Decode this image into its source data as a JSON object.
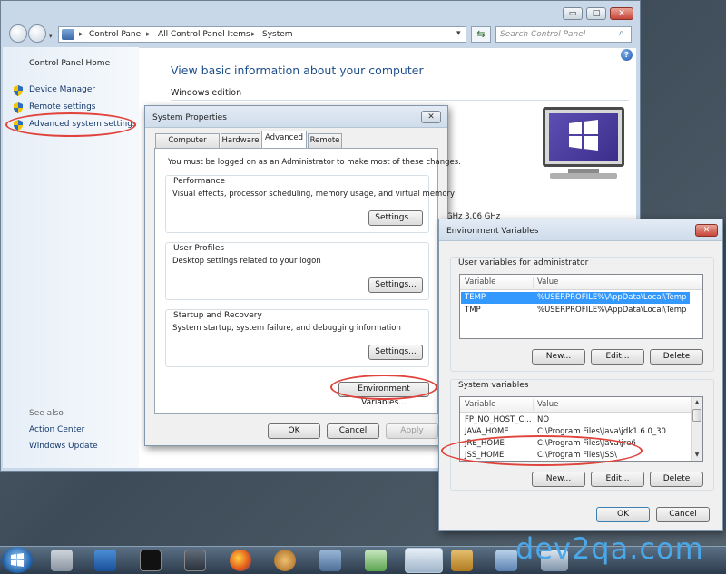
{
  "window": {
    "minimize_label": "▭",
    "maximize_label": "□",
    "close_label": "✕"
  },
  "address_bar": {
    "crumbs": [
      "Control Panel",
      "All Control Panel Items",
      "System"
    ],
    "separator": "▸",
    "refresh_icon": "refresh-icon"
  },
  "search": {
    "placeholder": "Search Control Panel"
  },
  "sidebar": {
    "home_label": "Control Panel Home",
    "items": [
      {
        "label": "Device Manager"
      },
      {
        "label": "Remote settings"
      },
      {
        "label": "Advanced system settings"
      }
    ],
    "see_also": "See also",
    "links": [
      "Action Center",
      "Windows Update"
    ]
  },
  "main": {
    "heading": "View basic information about your computer",
    "section": "Windows edition",
    "cpu_fragment": "GHz   3.06 GHz",
    "help_label": "?"
  },
  "system_properties": {
    "title": "System Properties",
    "close_label": "✕",
    "tabs": [
      "Computer Name",
      "Hardware",
      "Advanced",
      "Remote"
    ],
    "active_tab": "Advanced",
    "admin_note": "You must be logged on as an Administrator to make most of these changes.",
    "groups": [
      {
        "label": "Performance",
        "desc": "Visual effects, processor scheduling, memory usage, and virtual memory",
        "button": "Settings..."
      },
      {
        "label": "User Profiles",
        "desc": "Desktop settings related to your logon",
        "button": "Settings..."
      },
      {
        "label": "Startup and Recovery",
        "desc": "System startup, system failure, and debugging information",
        "button": "Settings..."
      }
    ],
    "env_button": "Environment Variables...",
    "ok": "OK",
    "cancel": "Cancel",
    "apply": "Apply"
  },
  "env_vars": {
    "title": "Environment Variables",
    "close_label": "✕",
    "user_group": "User variables for administrator",
    "col_variable": "Variable",
    "col_value": "Value",
    "user_rows": [
      {
        "name": "TEMP",
        "value": "%USERPROFILE%\\AppData\\Local\\Temp"
      },
      {
        "name": "TMP",
        "value": "%USERPROFILE%\\AppData\\Local\\Temp"
      }
    ],
    "system_group": "System variables",
    "system_rows": [
      {
        "name": "FP_NO_HOST_C...",
        "value": "NO"
      },
      {
        "name": "JAVA_HOME",
        "value": "C:\\Program Files\\Java\\jdk1.6.0_30"
      },
      {
        "name": "JRE_HOME",
        "value": "C:\\Program Files\\Java\\jre6"
      },
      {
        "name": "JSS_HOME",
        "value": "C:\\Program Files\\JSS\\"
      }
    ],
    "new": "New...",
    "edit": "Edit...",
    "delete": "Delete",
    "ok": "OK",
    "cancel": "Cancel"
  },
  "watermark": "dev2qa.com",
  "colors": {
    "accent": "#3399ff",
    "link": "#13376a",
    "heading": "#1e4f8c",
    "annotation": "#e0433b"
  }
}
